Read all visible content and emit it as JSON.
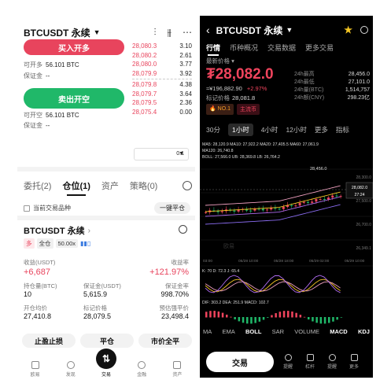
{
  "left": {
    "title": "BTCUSDT 永续",
    "buy_label": "买入开多",
    "sell_label": "卖出开空",
    "buy_open_label": "可开多",
    "buy_open_value": "56.101 BTC",
    "buy_margin_label": "保证金",
    "buy_margin_value": "--",
    "sell_open_label": "可开空",
    "sell_open_value": "56.101 BTC",
    "sell_margin_label": "保证金",
    "sell_margin_value": "--",
    "orderbook": [
      {
        "price": "28,080.3",
        "qty": "3.10",
        "side": "red"
      },
      {
        "price": "28,080.2",
        "qty": "2.61",
        "side": "red"
      },
      {
        "price": "28,080.0",
        "qty": "3.77",
        "side": "red"
      },
      {
        "price": "28,079.9",
        "qty": "3.92",
        "side": "red"
      },
      {
        "price": "28,079.8",
        "qty": "4.38",
        "side": "red"
      },
      {
        "price": "28,079.7",
        "qty": "3.64",
        "side": "red"
      },
      {
        "price": "28,079.5",
        "qty": "2.36",
        "side": "red"
      },
      {
        "price": "28,075.4",
        "qty": "0.00",
        "side": "red"
      }
    ],
    "depth": "0.1",
    "tabs": [
      "委托(2)",
      "仓位(1)",
      "资产",
      "策略(0)"
    ],
    "current_only_label": "当前交易品种",
    "close_all_label": "一键平仓",
    "position": {
      "symbol": "BTCUSDT 永续",
      "side": "多",
      "mode": "全仓",
      "leverage": "50.00x",
      "pnl_label": "收益(USDT)",
      "pnl_value": "+6,687",
      "roe_label": "收益率",
      "roe_value": "+121.97%",
      "size_label": "持仓量(BTC)",
      "size_value": "10",
      "margin_label": "保证金(USDT)",
      "margin_value": "5,615.9",
      "margin_ratio_label": "保证金率",
      "margin_ratio_value": "998.70%",
      "entry_label": "开仓均价",
      "entry_value": "27,410.8",
      "mark_label": "标记价格",
      "mark_value": "28,079.5",
      "liq_label": "预估强平价",
      "liq_value": "23,498.4"
    },
    "actions": [
      "止盈止损",
      "平仓",
      "市价全平"
    ],
    "nav": [
      "欧易",
      "发现",
      "交易",
      "金融",
      "资产"
    ]
  },
  "right": {
    "title": "BTCUSDT 永续",
    "tabs": [
      "行情",
      "币种概况",
      "交易数据",
      "更多交易"
    ],
    "latest_label": "最新价格",
    "price": "₮28,082.0",
    "cny_price": "≈¥196,882.90",
    "change": "+2.97%",
    "mark_label": "标记价格",
    "mark_value": "28,081.8",
    "badge_no1": "NO.1",
    "badge_main": "主流币",
    "stats": [
      {
        "k": "24h最高",
        "v": "28,456.0"
      },
      {
        "k": "24h最低",
        "v": "27,101.0"
      },
      {
        "k": "24h量(BTC)",
        "v": "1,514,757"
      },
      {
        "k": "24h额(CNY)",
        "v": "298.23亿"
      }
    ],
    "timeframes": [
      "30分",
      "1小时",
      "4小时",
      "12小时",
      "更多",
      "指标"
    ],
    "selected_timeframe": "1小时",
    "ma_line": "MA5: 28,120.9  MA10: 27,922.2  MA20: 27,405.5  MA60: 27,061.9",
    "ma_line2": "MA120: 26,740.8",
    "boll_line": "BOLL: 27,566.0  UB: 28,369.8  LB: 26,764.2",
    "high_label": "28,456.0",
    "price_tag": "28,082.0",
    "countdown": "27:24",
    "low_label": "26,349.1",
    "y_ticks": [
      "28,300.0",
      "27,500.0",
      "26,700.0",
      "26,349.1"
    ],
    "x_ticks": [
      "03:00",
      "05/28 10:00",
      "05/28 18:00",
      "05/29 02:00",
      "05/29 10:00"
    ],
    "kdj_line": "K: 70  D: 72.3  J: 65.4",
    "macd_line": "DIF: 303.2  DEA: 251.9  MACD: 102.7",
    "indicators": [
      "MA",
      "EMA",
      "BOLL",
      "SAR",
      "VOLUME",
      "MACD",
      "KDJ"
    ],
    "active_indicators": [
      "BOLL",
      "MACD",
      "KDJ"
    ],
    "trade_label": "交易",
    "bottom_nav": [
      "提醒",
      "杠杆",
      "提醒",
      "更多"
    ],
    "watermark": "欧易"
  },
  "colors": {
    "up": "#f0445d",
    "down": "#20b869",
    "accent": "#f5c623"
  }
}
